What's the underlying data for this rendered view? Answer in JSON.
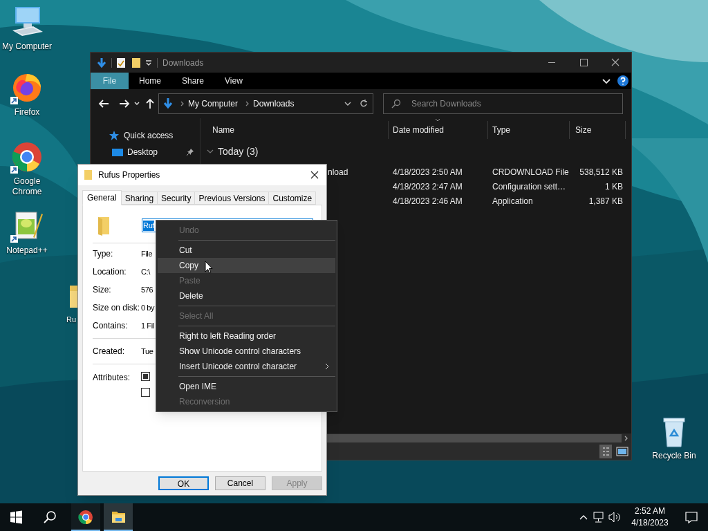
{
  "desktop_icons": [
    {
      "label": "My Computer",
      "kind": "computer"
    },
    {
      "label": "Firefox",
      "kind": "firefox"
    },
    {
      "label": "Google Chrome",
      "kind": "chrome"
    },
    {
      "label": "Notepad++",
      "kind": "notepad"
    },
    {
      "label": "Ru",
      "kind": "folder"
    },
    {
      "label": "Recycle Bin",
      "kind": "recycle"
    }
  ],
  "explorer": {
    "title": "Downloads",
    "ribbon_tabs": [
      {
        "label": "File",
        "kind": "file"
      },
      {
        "label": "Home",
        "kind": "tab"
      },
      {
        "label": "Share",
        "kind": "tab"
      },
      {
        "label": "View",
        "kind": "tab"
      }
    ],
    "breadcrumb": [
      "My Computer",
      "Downloads"
    ],
    "search": {
      "placeholder": "Search Downloads"
    },
    "nav_pane": [
      {
        "label": "Quick access",
        "kind": "star",
        "pinned": false
      },
      {
        "label": "Desktop",
        "kind": "desktop",
        "pinned": true
      }
    ],
    "columns": [
      "Name",
      "Date modified",
      "Type",
      "Size"
    ],
    "group": "Today (3)",
    "rows": [
      {
        "name": "nload",
        "date": "4/18/2023 2:50 AM",
        "type": "CRDOWNLOAD File",
        "size": "538,512 KB"
      },
      {
        "date": "4/18/2023 2:47 AM",
        "type": "Configuration sett…",
        "size": "1 KB"
      },
      {
        "date": "4/18/2023 2:46 AM",
        "type": "Application",
        "size": "1,387 KB"
      }
    ]
  },
  "properties": {
    "title": "Rufus Properties",
    "tabs": [
      {
        "label": "General",
        "selected": true
      },
      {
        "label": "Sharing",
        "selected": false
      },
      {
        "label": "Security",
        "selected": false
      },
      {
        "label": "Previous Versions",
        "selected": false
      },
      {
        "label": "Customize",
        "selected": false
      }
    ],
    "name_field": {
      "value": "Ruf"
    },
    "field_groups": [
      [
        {
          "label": "Type:",
          "value": "File"
        },
        {
          "label": "Location:",
          "value": "C:\\"
        },
        {
          "label": "Size:",
          "value": "576"
        },
        {
          "label": "Size on disk:",
          "value": "0 by"
        },
        {
          "label": "Contains:",
          "value": "1 Fil"
        }
      ],
      [
        {
          "label": "Created:",
          "value": "Tue"
        }
      ]
    ],
    "attributes": {
      "label": "Attributes:",
      "checkboxes": [
        {
          "checked": false,
          "indeterminate": true
        },
        {
          "checked": false,
          "indeterminate": false
        }
      ]
    },
    "buttons": [
      {
        "label": "OK",
        "default": true,
        "disabled": false
      },
      {
        "label": "Cancel",
        "default": false,
        "disabled": false
      },
      {
        "label": "Apply",
        "default": false,
        "disabled": true
      }
    ]
  },
  "context_menu": [
    {
      "kind": "item",
      "label": "Undo",
      "disabled": true,
      "selected": false,
      "submenu": false
    },
    {
      "kind": "separator"
    },
    {
      "kind": "item",
      "label": "Cut",
      "disabled": false,
      "selected": false,
      "submenu": false
    },
    {
      "kind": "item",
      "label": "Copy",
      "disabled": false,
      "selected": true,
      "submenu": false
    },
    {
      "kind": "item",
      "label": "Paste",
      "disabled": true,
      "selected": false,
      "submenu": false
    },
    {
      "kind": "item",
      "label": "Delete",
      "disabled": false,
      "selected": false,
      "submenu": false
    },
    {
      "kind": "separator"
    },
    {
      "kind": "item",
      "label": "Select All",
      "disabled": true,
      "selected": false,
      "submenu": false
    },
    {
      "kind": "separator"
    },
    {
      "kind": "item",
      "label": "Right to left Reading order",
      "disabled": false,
      "selected": false,
      "submenu": false
    },
    {
      "kind": "item",
      "label": "Show Unicode control characters",
      "disabled": false,
      "selected": false,
      "submenu": false
    },
    {
      "kind": "item",
      "label": "Insert Unicode control character",
      "disabled": false,
      "selected": false,
      "submenu": true
    },
    {
      "kind": "separator"
    },
    {
      "kind": "item",
      "label": "Open IME",
      "disabled": false,
      "selected": false,
      "submenu": false
    },
    {
      "kind": "item",
      "label": "Reconversion",
      "disabled": true,
      "selected": false,
      "submenu": false
    }
  ],
  "taskbar": {
    "apps": [
      {
        "kind": "chrome",
        "active": false
      },
      {
        "kind": "explorer",
        "active": true
      }
    ],
    "time": "2:52 AM",
    "date": "4/18/2023"
  }
}
